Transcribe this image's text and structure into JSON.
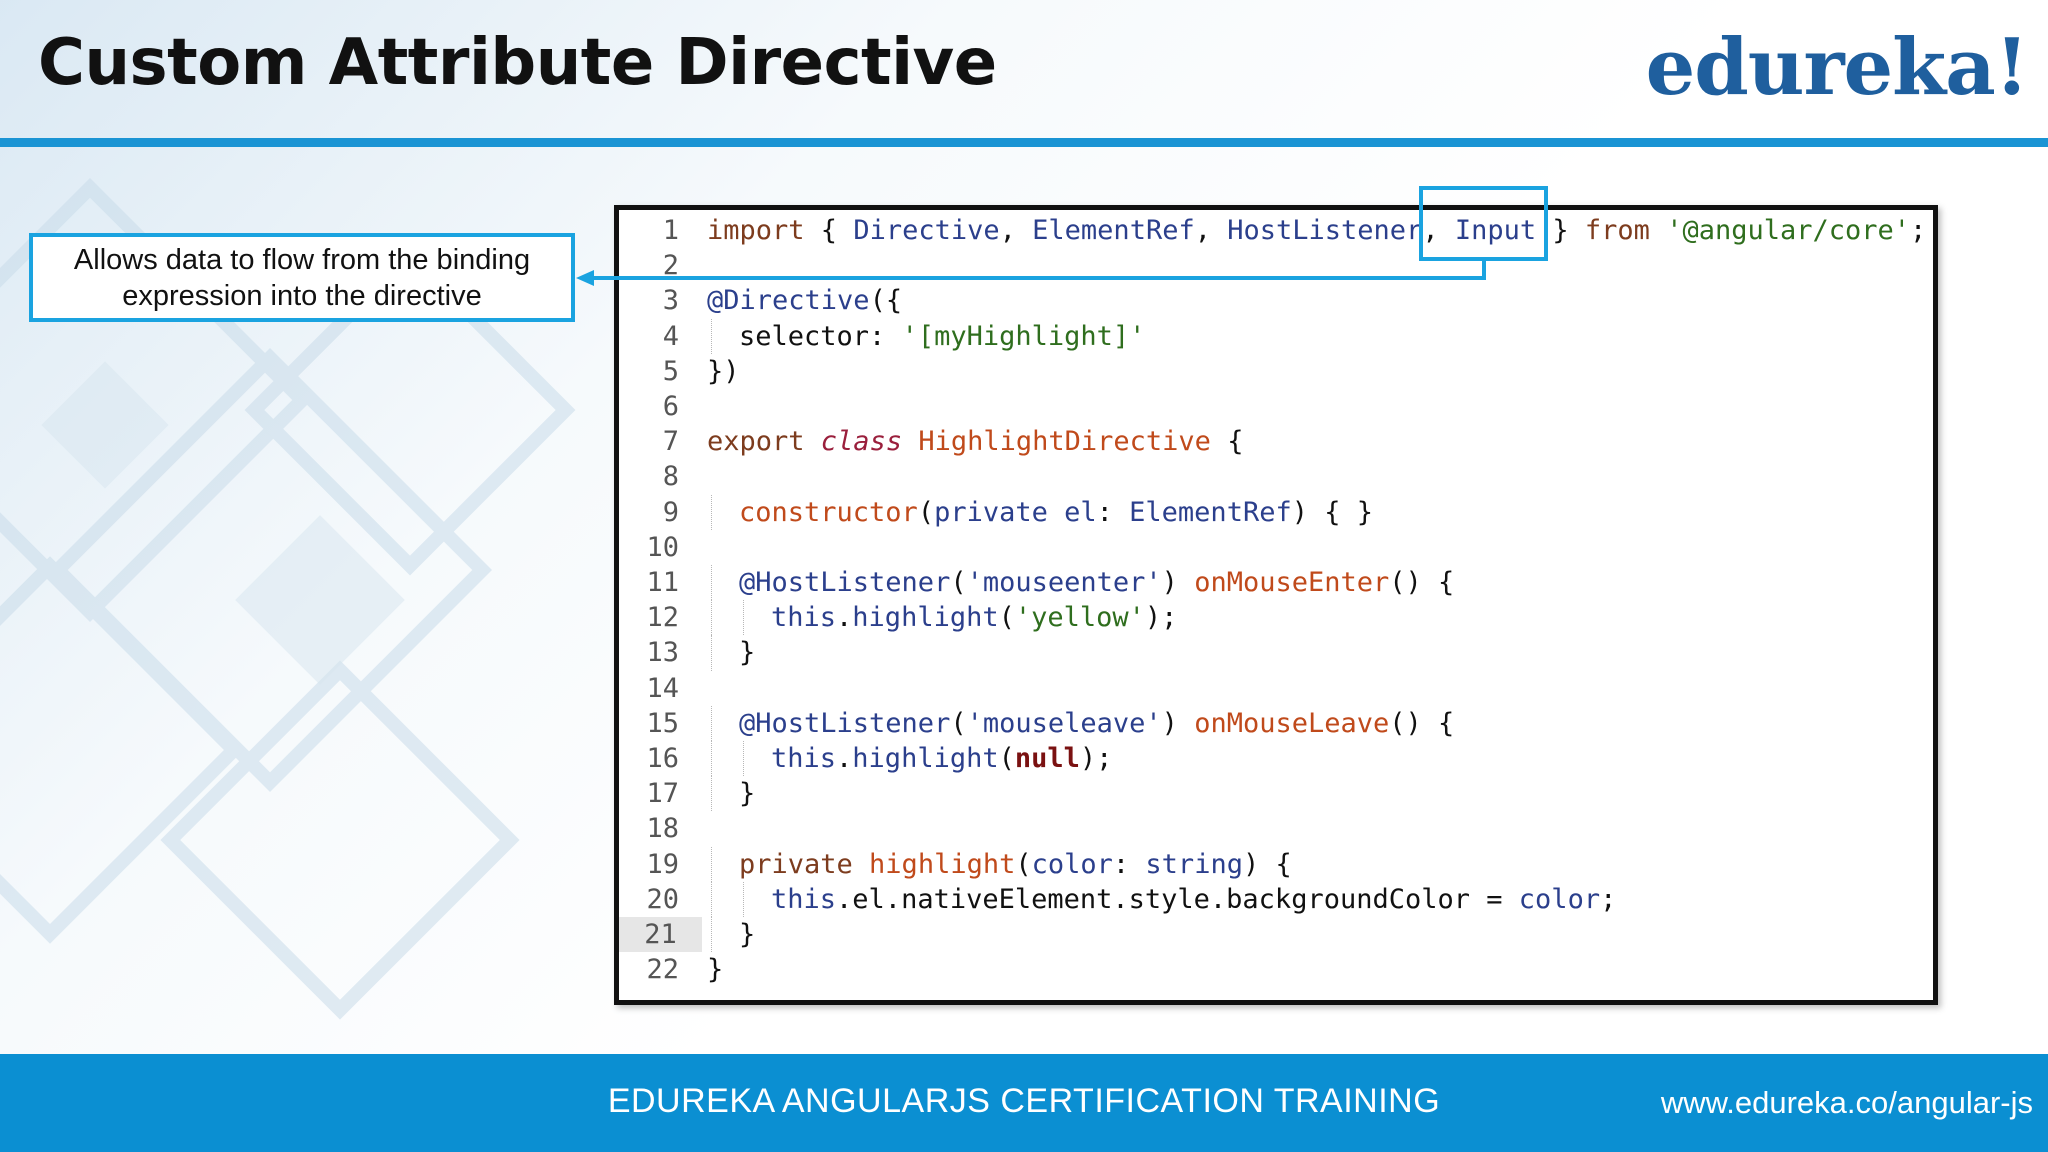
{
  "slide": {
    "title": "Custom Attribute Directive",
    "brand": "edureka!",
    "callout_lines": [
      "Allows data to flow from the binding",
      "expression into the directive"
    ]
  },
  "footer": {
    "title": "EDUREKA ANGULARJS CERTIFICATION TRAINING",
    "url": "www.edureka.co/angular-js"
  },
  "code": {
    "active_line": 21,
    "highlighted_token": "Input",
    "lines": [
      {
        "n": "1",
        "indent": 0,
        "tokens": [
          [
            "k-kw",
            "import"
          ],
          [
            "k-punc",
            " { "
          ],
          [
            "k-type",
            "Directive"
          ],
          [
            "k-punc",
            ", "
          ],
          [
            "k-type",
            "ElementRef"
          ],
          [
            "k-punc",
            ", "
          ],
          [
            "k-type",
            "HostListener"
          ],
          [
            "k-punc",
            ", "
          ],
          [
            "k-type",
            "Input"
          ],
          [
            "k-punc",
            " } "
          ],
          [
            "k-kw",
            "from"
          ],
          [
            "k-punc",
            " "
          ],
          [
            "k-str",
            "'@angular/core'"
          ],
          [
            "k-punc",
            ";"
          ]
        ]
      },
      {
        "n": "2",
        "indent": 0,
        "tokens": []
      },
      {
        "n": "3",
        "indent": 0,
        "tokens": [
          [
            "k-dec",
            "@Directive"
          ],
          [
            "k-punc",
            "({"
          ]
        ]
      },
      {
        "n": "4",
        "indent": 1,
        "tokens": [
          [
            "k-punc",
            "selector: "
          ],
          [
            "k-str",
            "'[myHighlight]'"
          ]
        ]
      },
      {
        "n": "5",
        "indent": 0,
        "tokens": [
          [
            "k-punc",
            "})"
          ]
        ]
      },
      {
        "n": "6",
        "indent": 0,
        "tokens": []
      },
      {
        "n": "7",
        "indent": 0,
        "tokens": [
          [
            "k-kw",
            "export "
          ],
          [
            "k-ital",
            "class"
          ],
          [
            "k-punc",
            " "
          ],
          [
            "k-fn",
            "HighlightDirective"
          ],
          [
            "k-punc",
            " {"
          ]
        ]
      },
      {
        "n": "8",
        "indent": 0,
        "tokens": []
      },
      {
        "n": "9",
        "indent": 1,
        "tokens": [
          [
            "k-fn",
            "constructor"
          ],
          [
            "k-punc",
            "("
          ],
          [
            "k-type",
            "private el"
          ],
          [
            "k-punc",
            ": "
          ],
          [
            "k-type",
            "ElementRef"
          ],
          [
            "k-punc",
            ") { }"
          ]
        ]
      },
      {
        "n": "10",
        "indent": 0,
        "tokens": []
      },
      {
        "n": "11",
        "indent": 1,
        "tokens": [
          [
            "k-dec",
            "@HostListener"
          ],
          [
            "k-punc",
            "("
          ],
          [
            "k-type",
            "'mouseenter'"
          ],
          [
            "k-punc",
            ") "
          ],
          [
            "k-fn",
            "onMouseEnter"
          ],
          [
            "k-punc",
            "() {"
          ]
        ]
      },
      {
        "n": "12",
        "indent": 2,
        "tokens": [
          [
            "k-type",
            "this"
          ],
          [
            "k-punc",
            "."
          ],
          [
            "k-type",
            "highlight"
          ],
          [
            "k-punc",
            "("
          ],
          [
            "k-str",
            "'yellow'"
          ],
          [
            "k-punc",
            ");"
          ]
        ]
      },
      {
        "n": "13",
        "indent": 1,
        "tokens": [
          [
            "k-punc",
            "}"
          ]
        ]
      },
      {
        "n": "14",
        "indent": 0,
        "tokens": []
      },
      {
        "n": "15",
        "indent": 1,
        "tokens": [
          [
            "k-dec",
            "@HostListener"
          ],
          [
            "k-punc",
            "("
          ],
          [
            "k-type",
            "'mouseleave'"
          ],
          [
            "k-punc",
            ") "
          ],
          [
            "k-fn",
            "onMouseLeave"
          ],
          [
            "k-punc",
            "() {"
          ]
        ]
      },
      {
        "n": "16",
        "indent": 2,
        "tokens": [
          [
            "k-type",
            "this"
          ],
          [
            "k-punc",
            "."
          ],
          [
            "k-type",
            "highlight"
          ],
          [
            "k-punc",
            "("
          ],
          [
            "k-bold",
            "null"
          ],
          [
            "k-punc",
            ");"
          ]
        ]
      },
      {
        "n": "17",
        "indent": 1,
        "tokens": [
          [
            "k-punc",
            "}"
          ]
        ]
      },
      {
        "n": "18",
        "indent": 0,
        "tokens": []
      },
      {
        "n": "19",
        "indent": 1,
        "tokens": [
          [
            "k-kw",
            "private "
          ],
          [
            "k-fn",
            "highlight"
          ],
          [
            "k-punc",
            "("
          ],
          [
            "k-type",
            "color"
          ],
          [
            "k-punc",
            ": "
          ],
          [
            "k-type",
            "string"
          ],
          [
            "k-punc",
            ") {"
          ]
        ]
      },
      {
        "n": "20",
        "indent": 2,
        "tokens": [
          [
            "k-type",
            "this"
          ],
          [
            "k-punc",
            "."
          ],
          [
            "k-punc",
            "el.nativeElement.style.backgroundColor"
          ],
          [
            "k-punc",
            " = "
          ],
          [
            "k-type",
            "color"
          ],
          [
            "k-punc",
            ";"
          ]
        ]
      },
      {
        "n": "21",
        "indent": 1,
        "tokens": [
          [
            "k-punc",
            "}"
          ]
        ]
      },
      {
        "n": "22",
        "indent": 0,
        "tokens": [
          [
            "k-punc",
            "}"
          ]
        ]
      }
    ]
  },
  "colors": {
    "accent": "#1a94d4",
    "brand": "#1f5f9e",
    "callout_border": "#1aa3e0",
    "footer_bg": "#0b8fd2"
  }
}
